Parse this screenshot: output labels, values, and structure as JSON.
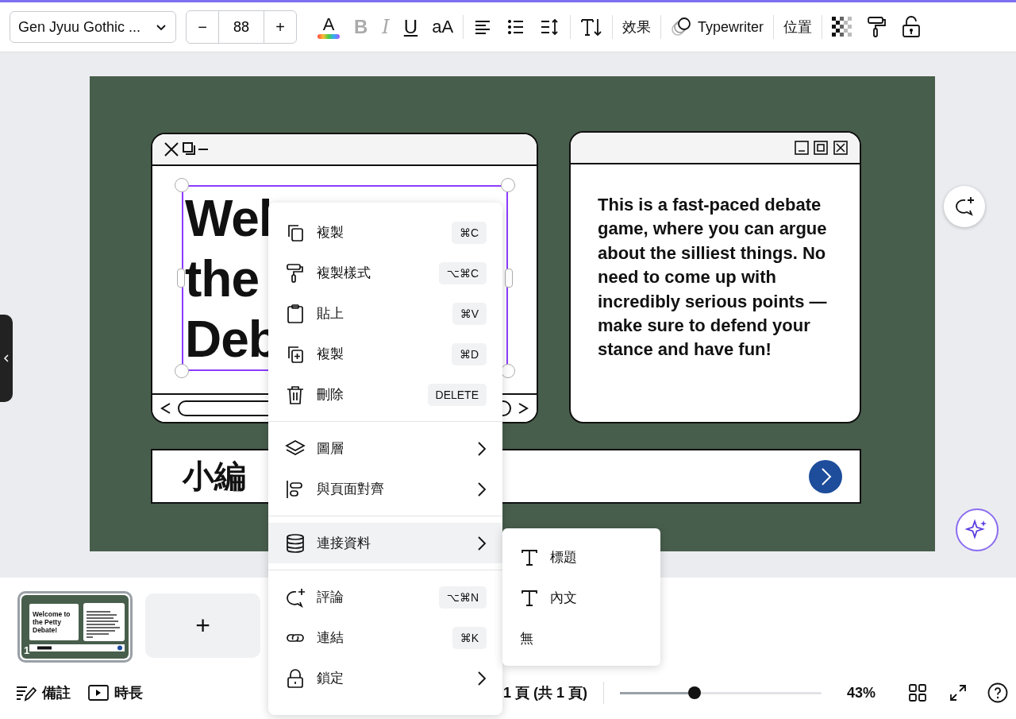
{
  "toolbar": {
    "font": "Gen Jyuu Gothic ...",
    "size": {
      "minus": "−",
      "value": "88",
      "plus": "+"
    },
    "tool_groups": [
      [
        {
          "kind": "text-color",
          "label": "A"
        },
        {
          "kind": "bold",
          "label": "B",
          "disabled": true
        },
        {
          "kind": "italic",
          "label": "I",
          "disabled": true
        },
        {
          "kind": "underline",
          "label": "U",
          "disabled": false
        },
        {
          "kind": "case",
          "label": "aA"
        }
      ],
      [
        {
          "kind": "align"
        },
        {
          "kind": "list"
        },
        {
          "kind": "spacing"
        }
      ],
      [
        {
          "kind": "vertical"
        }
      ],
      [
        {
          "kind": "text",
          "label": "效果"
        }
      ],
      [
        {
          "kind": "animation",
          "label": "Typewriter"
        }
      ],
      [
        {
          "kind": "text",
          "label": "位置"
        }
      ],
      [
        {
          "kind": "transparency"
        },
        {
          "kind": "paint"
        },
        {
          "kind": "lock"
        }
      ]
    ]
  },
  "slide": {
    "title_lines": [
      "Wel",
      "the",
      "Deb"
    ],
    "body": "This is a fast-paced debate game, where you can argue about the silliest things. No need to come up with incredibly serious points — make sure to defend your stance and have fun!",
    "bar_text": "小編"
  },
  "context_menu": [
    [
      {
        "kind": "copy",
        "label": "複製",
        "shortcut": "⌘C",
        "submenu": false,
        "selected": false
      },
      {
        "kind": "copy-style",
        "label": "複製樣式",
        "shortcut": "⌥⌘C",
        "submenu": false,
        "selected": false
      },
      {
        "kind": "paste",
        "label": "貼上",
        "shortcut": "⌘V",
        "submenu": false,
        "selected": false
      },
      {
        "kind": "duplicate",
        "label": "複製",
        "shortcut": "⌘D",
        "submenu": false,
        "selected": false
      },
      {
        "kind": "delete",
        "label": "刪除",
        "shortcut": "DELETE",
        "submenu": false,
        "selected": false
      }
    ],
    [
      {
        "kind": "layers",
        "label": "圖層",
        "submenu": true,
        "selected": false
      },
      {
        "kind": "align",
        "label": "與頁面對齊",
        "submenu": true,
        "selected": false
      }
    ],
    [
      {
        "kind": "data",
        "label": "連接資料",
        "submenu": true,
        "selected": true
      }
    ],
    [
      {
        "kind": "comment",
        "label": "評論",
        "shortcut": "⌥⌘N",
        "submenu": false,
        "selected": false
      },
      {
        "kind": "link",
        "label": "連結",
        "shortcut": "⌘K",
        "submenu": false,
        "selected": false
      },
      {
        "kind": "lock",
        "label": "鎖定",
        "submenu": true,
        "selected": false
      }
    ]
  ],
  "submenu": [
    {
      "kind": "heading",
      "label": "標題"
    },
    {
      "kind": "body",
      "label": "內文"
    },
    {
      "kind": "none",
      "label": "無"
    }
  ],
  "pages": [
    {
      "number": "1",
      "selected": true,
      "title": "Welcome to the Petty Debate!"
    }
  ],
  "add_page": "+",
  "status_bar": {
    "notes": "備註",
    "duration": "時長",
    "page": "1 頁 (共 1 頁)",
    "zoom": {
      "level": 0.37,
      "reading": "43%"
    }
  }
}
